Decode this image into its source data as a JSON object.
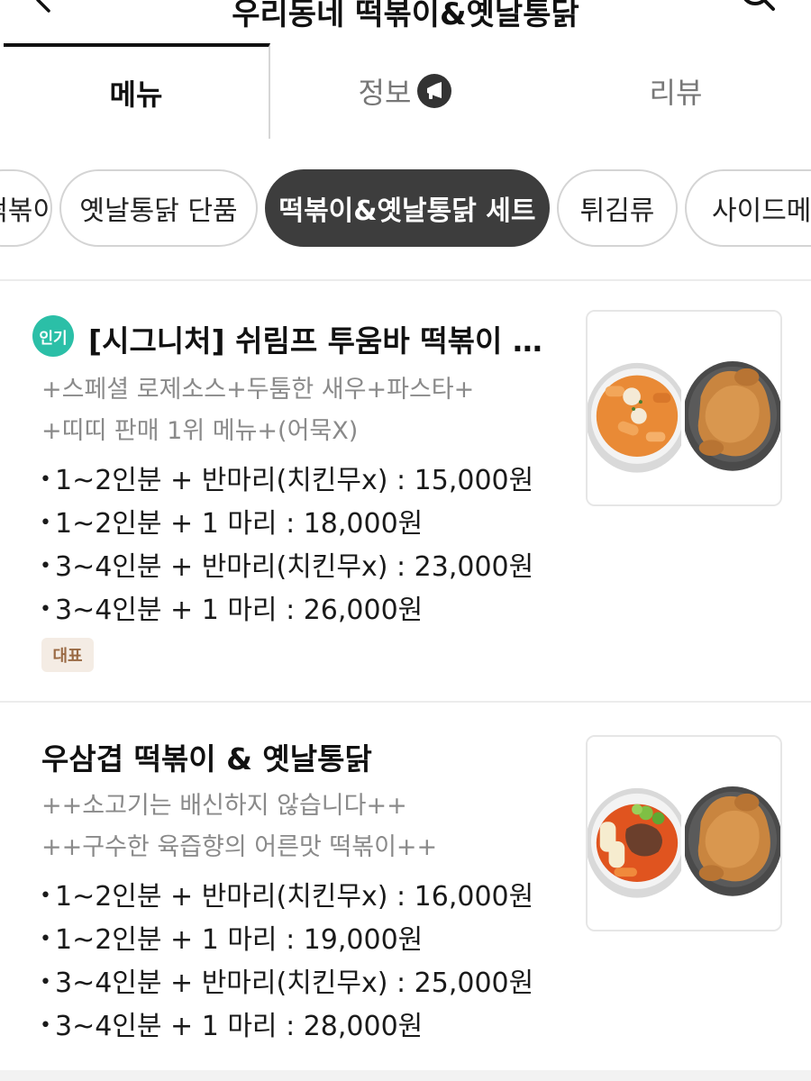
{
  "header": {
    "title": "우리동네 떡볶이&옛날통닭"
  },
  "tabs": [
    {
      "label": "메뉴",
      "active": true
    },
    {
      "label": "정보",
      "active": false
    },
    {
      "label": "리뷰",
      "active": false
    }
  ],
  "categories": [
    {
      "label": "떡볶이",
      "active": false
    },
    {
      "label": "옛날통닭 단품",
      "active": false
    },
    {
      "label": "떡볶이&옛날통닭 세트",
      "active": true
    },
    {
      "label": "튀김류",
      "active": false
    },
    {
      "label": "사이드메뉴",
      "active": false
    }
  ],
  "menu_items": [
    {
      "badge": "인기",
      "title": "[시그니처] 쉬림프 투움바 떡볶이 &...",
      "description": [
        "+스페셜 로제소스+두툼한 새우+파스타+",
        "+띠띠 판매 1위 메뉴+(어묵X)"
      ],
      "prices": [
        "1~2인분 + 반마리(치킨무x) : 15,000원",
        "1~2인분 + 1 마리 : 18,000원",
        "3~4인분 + 반마리(치킨무x) : 23,000원",
        "3~4인분 + 1 마리 : 26,000원"
      ],
      "tag": "대표",
      "image": "tteokbokki-rose-and-fried-chicken-photo"
    },
    {
      "title": "우삼겹 떡볶이 & 옛날통닭",
      "description": [
        "++소고기는 배신하지 않습니다++",
        "++구수한 육즙향의 어른맛 떡볶이++"
      ],
      "prices": [
        "1~2인분 + 반마리(치킨무x) : 16,000원",
        "1~2인분 + 1 마리 : 19,000원",
        "3~4인분 + 반마리(치킨무x) : 25,000원",
        "3~4인분 + 1 마리 : 28,000원"
      ],
      "image": "beef-brisket-tteokbokki-and-fried-chicken-photo"
    }
  ],
  "colors": {
    "accent_popular": "#2bbfa7",
    "active_chip": "#3d3d3d",
    "rep_tag_bg": "#f4ece4",
    "rep_tag_text": "#9a6a44"
  }
}
